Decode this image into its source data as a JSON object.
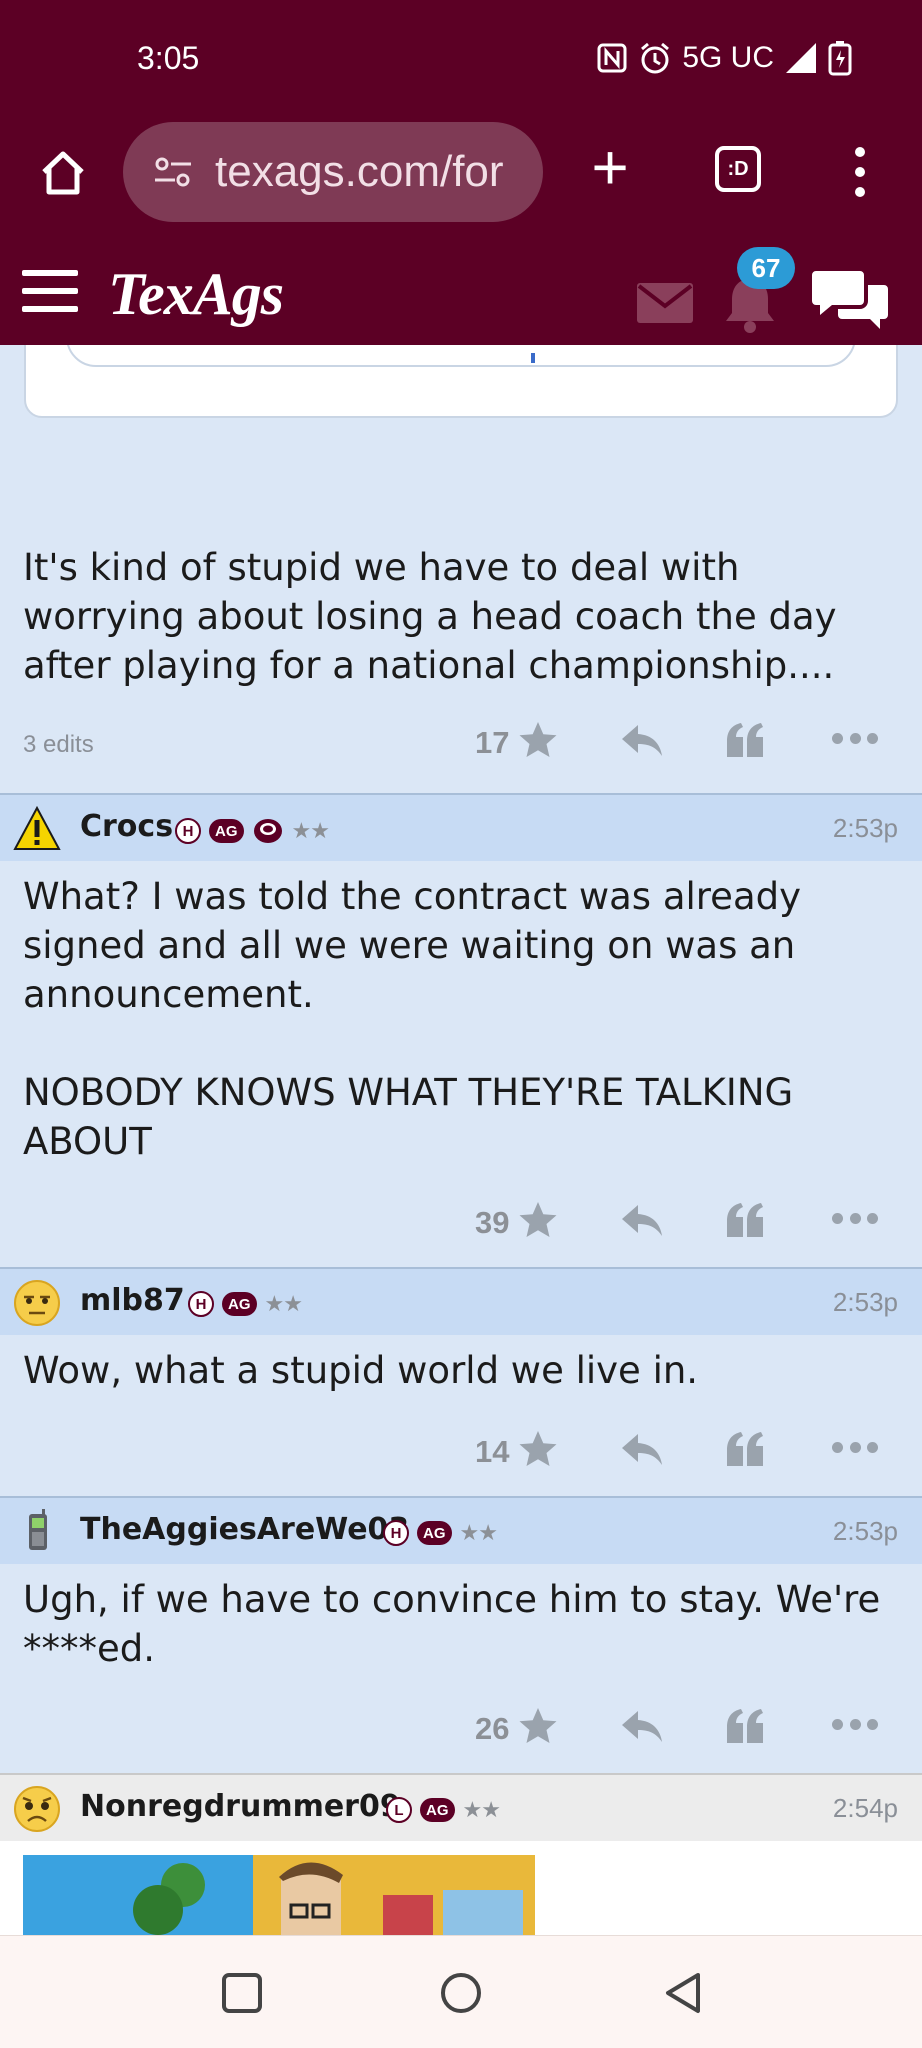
{
  "status_bar": {
    "time": "3:05",
    "network": "5G UC",
    "icons": [
      "nfc-icon",
      "alarm-icon",
      "signal-icon",
      "battery-charging-icon"
    ]
  },
  "browser": {
    "url": "texags.com/for",
    "tabs_label": ":D"
  },
  "site_header": {
    "logo": "TexAgs",
    "notification_count": "67"
  },
  "posts": [
    {
      "text": "It's kind of stupid we have to deal with worrying about losing a head coach the day after playing for a national championship....",
      "edits": "3 edits",
      "likes": "17"
    },
    {
      "username": "Crocs",
      "badges": [
        "H",
        "AG"
      ],
      "stars": "★★",
      "time": "2:53p",
      "avatar": "warning-icon",
      "text": "What? I was told the contract was already signed and all we were waiting on was an announcement.\n\nNOBODY KNOWS WHAT THEY'RE TALKING ABOUT",
      "likes": "39"
    },
    {
      "username": "mlb87",
      "badges": [
        "H",
        "AG"
      ],
      "stars": "★★",
      "time": "2:53p",
      "avatar": "skeptical-face-icon",
      "text": "Wow, what a stupid world we live in.",
      "likes": "14"
    },
    {
      "username": "TheAggiesAreWe03",
      "badges": [
        "H",
        "AG"
      ],
      "stars": "★★",
      "time": "2:53p",
      "avatar": "cellphone-icon",
      "text": "Ugh, if we have to convince him to stay. We're ****ed.",
      "likes": "26"
    },
    {
      "username": "Nonregdrummer09",
      "badges": [
        "L",
        "AG"
      ],
      "stars": "★★",
      "time": "2:54p",
      "avatar": "worried-face-icon"
    }
  ],
  "colors": {
    "maroon": "#5c0025",
    "post_bg": "#dbe7f6",
    "header_bg": "#c7dbf4",
    "badge_blue": "#2c9bd6"
  }
}
